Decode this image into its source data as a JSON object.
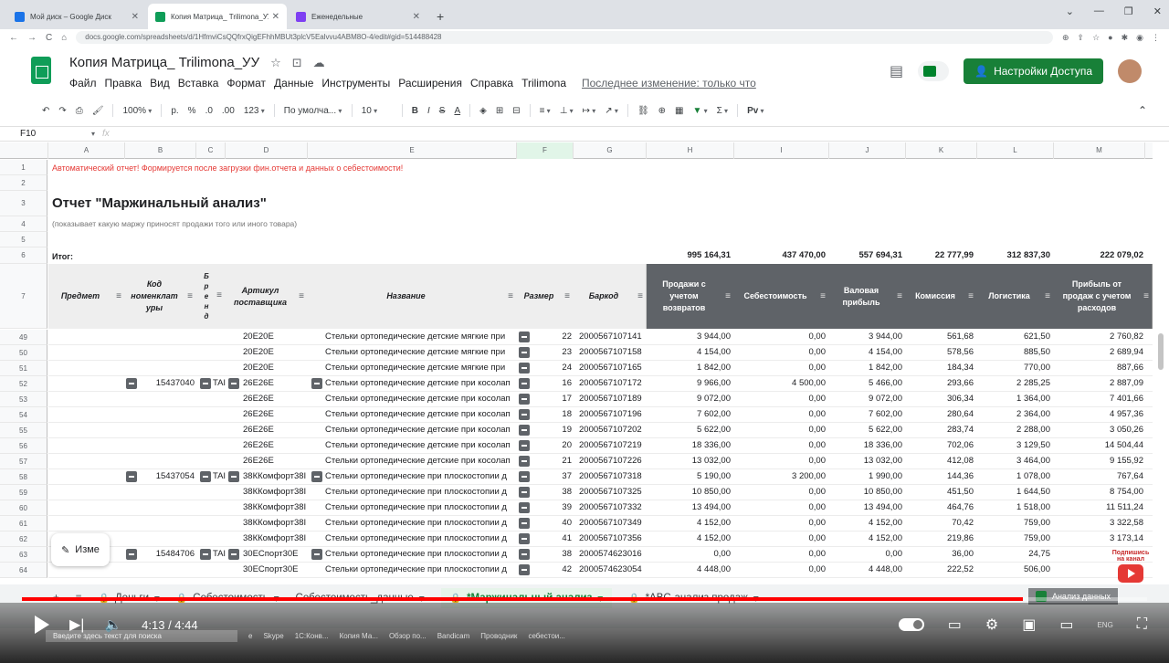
{
  "browser": {
    "tabs": [
      {
        "title": "Мой диск – Google Диск",
        "color": "#1a73e8"
      },
      {
        "title": "Копия Матрица_ Trilimona_УУ – ",
        "color": "#0f9d58"
      },
      {
        "title": "Еженедельные",
        "color": "#7e3ff2"
      }
    ],
    "url": "docs.google.com/spreadsheets/d/1HfmviCsQQfrxQigEFhhMBUt3plcV5Ealvvu4ABM8O-4/edit#gid=514488428"
  },
  "app": {
    "title": "Копия  Матрица_ Trilimona_УУ",
    "menus": [
      "Файл",
      "Правка",
      "Вид",
      "Вставка",
      "Формат",
      "Данные",
      "Инструменты",
      "Расширения",
      "Справка",
      "Trilimona"
    ],
    "last_edit": "Последнее изменение: только что",
    "share_label": "Настройки Доступа"
  },
  "toolbar": {
    "zoom": "100%",
    "currency": "р.",
    "percent": "%",
    "dec_less": ".0",
    "dec_more": ".00",
    "format": "123",
    "font": "По умолча...",
    "size": "10",
    "bold": "B",
    "italic": "I",
    "strike": "S",
    "textcolor": "A",
    "sigma": "Σ",
    "py": "Pv"
  },
  "formula_bar": {
    "cell": "F10",
    "fx": "fx"
  },
  "columns": [
    "A",
    "B",
    "C",
    "D",
    "E",
    "F",
    "G",
    "H",
    "I",
    "J",
    "K",
    "L",
    "M"
  ],
  "rows_top": [
    "1",
    "2",
    "3",
    "4",
    "5",
    "6",
    "7"
  ],
  "sheet": {
    "notice": "Автоматический отчет! Формируется после загрузки фин.отчета и данных о себестоимости!",
    "report_title": "Отчет \"Маржинальный анализ\"",
    "report_subtitle": "(показывает какую маржу приносят продажи того или иного товара)",
    "total_label": "Итог:",
    "totals": [
      "995 164,31",
      "437 470,00",
      "557 694,31",
      "22 777,99",
      "312 837,30",
      "222 079,02"
    ],
    "headers": {
      "subject": "Предмет",
      "nomen_code": "Код номенклат уры",
      "brand": "Б р е н д",
      "article": "Артикул поставщика",
      "name": "Название",
      "size": "Размер",
      "barcode": "Баркод",
      "sales": "Продажи с учетом возвратов",
      "cost": "Себестоимость",
      "gross": "Валовая прибыль",
      "commission": "Комиссия",
      "logistics": "Логистика",
      "profit": "Прибыль от продаж с учетом расходов"
    },
    "rows": [
      {
        "n": "49",
        "code": "",
        "brand": "",
        "art": "20E20E",
        "name": "Стельки ортопедические детские мягкие при",
        "size": "22",
        "bar": "2000567107141",
        "sales": "3 944,00",
        "cost": "0,00",
        "gross": "3 944,00",
        "comm": "561,68",
        "log": "621,50",
        "profit": "2 760,82"
      },
      {
        "n": "50",
        "code": "",
        "brand": "",
        "art": "20E20E",
        "name": "Стельки ортопедические детские мягкие при",
        "size": "23",
        "bar": "2000567107158",
        "sales": "4 154,00",
        "cost": "0,00",
        "gross": "4 154,00",
        "comm": "578,56",
        "log": "885,50",
        "profit": "2 689,94"
      },
      {
        "n": "51",
        "code": "",
        "brand": "",
        "art": "20E20E",
        "name": "Стельки ортопедические детские мягкие при",
        "size": "24",
        "bar": "2000567107165",
        "sales": "1 842,00",
        "cost": "0,00",
        "gross": "1 842,00",
        "comm": "184,34",
        "log": "770,00",
        "profit": "887,66"
      },
      {
        "n": "52",
        "code": "15437040",
        "brand": "TAI",
        "art": "26E26E",
        "name": "Стельки ортопедические детские при косолап",
        "size": "16",
        "bar": "2000567107172",
        "sales": "9 966,00",
        "cost": "4 500,00",
        "gross": "5 466,00",
        "comm": "293,66",
        "log": "2 285,25",
        "profit": "2 887,09"
      },
      {
        "n": "53",
        "code": "",
        "brand": "",
        "art": "26E26E",
        "name": "Стельки ортопедические детские при косолап",
        "size": "17",
        "bar": "2000567107189",
        "sales": "9 072,00",
        "cost": "0,00",
        "gross": "9 072,00",
        "comm": "306,34",
        "log": "1 364,00",
        "profit": "7 401,66"
      },
      {
        "n": "54",
        "code": "",
        "brand": "",
        "art": "26E26E",
        "name": "Стельки ортопедические детские при косолап",
        "size": "18",
        "bar": "2000567107196",
        "sales": "7 602,00",
        "cost": "0,00",
        "gross": "7 602,00",
        "comm": "280,64",
        "log": "2 364,00",
        "profit": "4 957,36"
      },
      {
        "n": "55",
        "code": "",
        "brand": "",
        "art": "26E26E",
        "name": "Стельки ортопедические детские при косолап",
        "size": "19",
        "bar": "2000567107202",
        "sales": "5 622,00",
        "cost": "0,00",
        "gross": "5 622,00",
        "comm": "283,74",
        "log": "2 288,00",
        "profit": "3 050,26"
      },
      {
        "n": "56",
        "code": "",
        "brand": "",
        "art": "26E26E",
        "name": "Стельки ортопедические детские при косолап",
        "size": "20",
        "bar": "2000567107219",
        "sales": "18 336,00",
        "cost": "0,00",
        "gross": "18 336,00",
        "comm": "702,06",
        "log": "3 129,50",
        "profit": "14 504,44"
      },
      {
        "n": "57",
        "code": "",
        "brand": "",
        "art": "26E26E",
        "name": "Стельки ортопедические детские при косолап",
        "size": "21",
        "bar": "2000567107226",
        "sales": "13 032,00",
        "cost": "0,00",
        "gross": "13 032,00",
        "comm": "412,08",
        "log": "3 464,00",
        "profit": "9 155,92"
      },
      {
        "n": "58",
        "code": "15437054",
        "brand": "TAI",
        "art": "38ККомфорт38I",
        "name": "Стельки ортопедические при плоскостопии д",
        "size": "37",
        "bar": "2000567107318",
        "sales": "5 190,00",
        "cost": "3 200,00",
        "gross": "1 990,00",
        "comm": "144,36",
        "log": "1 078,00",
        "profit": "767,64"
      },
      {
        "n": "59",
        "code": "",
        "brand": "",
        "art": "38ККомфорт38I",
        "name": "Стельки ортопедические при плоскостопии д",
        "size": "38",
        "bar": "2000567107325",
        "sales": "10 850,00",
        "cost": "0,00",
        "gross": "10 850,00",
        "comm": "451,50",
        "log": "1 644,50",
        "profit": "8 754,00"
      },
      {
        "n": "60",
        "code": "",
        "brand": "",
        "art": "38ККомфорт38I",
        "name": "Стельки ортопедические при плоскостопии д",
        "size": "39",
        "bar": "2000567107332",
        "sales": "13 494,00",
        "cost": "0,00",
        "gross": "13 494,00",
        "comm": "464,76",
        "log": "1 518,00",
        "profit": "11 511,24"
      },
      {
        "n": "61",
        "code": "",
        "brand": "",
        "art": "38ККомфорт38I",
        "name": "Стельки ортопедические при плоскостопии д",
        "size": "40",
        "bar": "2000567107349",
        "sales": "4 152,00",
        "cost": "0,00",
        "gross": "4 152,00",
        "comm": "70,42",
        "log": "759,00",
        "profit": "3 322,58"
      },
      {
        "n": "62",
        "code": "",
        "brand": "",
        "art": "38ККомфорт38I",
        "name": "Стельки ортопедические при плоскостопии д",
        "size": "41",
        "bar": "2000567107356",
        "sales": "4 152,00",
        "cost": "0,00",
        "gross": "4 152,00",
        "comm": "219,86",
        "log": "759,00",
        "profit": "3 173,14"
      },
      {
        "n": "63",
        "code": "15484706",
        "brand": "TAI",
        "art": "30ЕСпорт30Е",
        "name": "Стельки ортопедические при плоскостопии д",
        "size": "38",
        "bar": "2000574623016",
        "sales": "0,00",
        "cost": "0,00",
        "gross": "0,00",
        "comm": "36,00",
        "log": "24,75",
        "profit": ""
      },
      {
        "n": "64",
        "code": "",
        "brand": "",
        "art": "30ЕСпорт30Е",
        "name": "Стельки ортопедические при плоскостопии д",
        "size": "42",
        "bar": "2000574623054",
        "sales": "4 448,00",
        "cost": "0,00",
        "gross": "4 448,00",
        "comm": "222,52",
        "log": "506,00",
        "profit": ""
      }
    ]
  },
  "edit_fab": "Изме",
  "subscribe": "Подпишись на канал",
  "sheet_tabs": [
    "Деньги",
    "Себестоимость",
    "Себестоимость_данные",
    "*Маржинальный анализ",
    "*ABC-анализ продаж"
  ],
  "explore_label": "Анализ данных",
  "player": {
    "time": "4:13 / 4:44",
    "progress": 0.89,
    "search_placeholder": "Введите здесь текст для поиска",
    "taskbar_items": [
      "Skype",
      "1С:Конв...",
      "Копия Ма...",
      "Обзор по...",
      "Bandicam",
      "Проводник",
      "себестои..."
    ],
    "lang": "ENG"
  }
}
